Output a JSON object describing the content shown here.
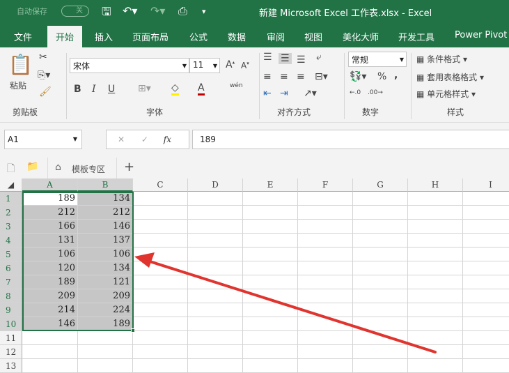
{
  "titlebar": {
    "autosave": "自动保存",
    "toggle": "关",
    "title": "新建 Microsoft Excel 工作表.xlsx  -  Excel"
  },
  "tabs": [
    "文件",
    "开始",
    "插入",
    "页面布局",
    "公式",
    "数据",
    "审阅",
    "视图",
    "美化大师",
    "开发工具",
    "Power Pivot"
  ],
  "ribbon": {
    "paste": "粘贴",
    "clipboard": "剪贴板",
    "font_name": "宋体",
    "font_size": "11",
    "font": "字体",
    "bold": "B",
    "italic": "I",
    "underline": "U",
    "wen": "wén",
    "align": "对齐方式",
    "number_format": "常规",
    "number": "数字",
    "cond_format": "条件格式",
    "table_format": "套用表格格式",
    "cell_style": "单元格样式",
    "styles": "样式",
    "percent": "%",
    "comma": ","
  },
  "formula": {
    "name_box": "A1",
    "fx": "fx",
    "value": "189"
  },
  "sheettabs": {
    "template": "模板专区",
    "add": "+"
  },
  "columns": [
    "A",
    "B",
    "C",
    "D",
    "E",
    "F",
    "G",
    "H",
    "I"
  ],
  "rows": [
    "1",
    "2",
    "3",
    "4",
    "5",
    "6",
    "7",
    "8",
    "9",
    "10",
    "11",
    "12",
    "13"
  ],
  "data": [
    [
      "189",
      "134"
    ],
    [
      "212",
      "212"
    ],
    [
      "166",
      "146"
    ],
    [
      "131",
      "137"
    ],
    [
      "106",
      "106"
    ],
    [
      "120",
      "134"
    ],
    [
      "189",
      "121"
    ],
    [
      "209",
      "209"
    ],
    [
      "214",
      "224"
    ],
    [
      "146",
      "189"
    ]
  ],
  "colors": {
    "green": "#217346",
    "arrow": "#e0342f"
  }
}
